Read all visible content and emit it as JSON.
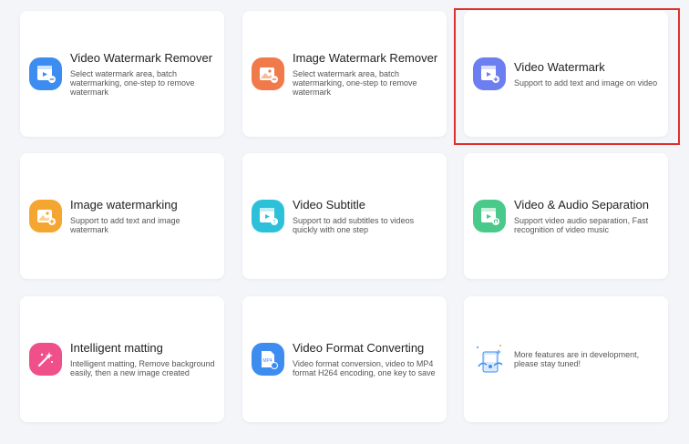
{
  "cards": [
    {
      "title": "Video Watermark Remover",
      "desc": "Select watermark area, batch watermarking, one-step to remove watermark",
      "color": "#3d8df0",
      "icon": "video-watermark-remover-icon"
    },
    {
      "title": "Image Watermark Remover",
      "desc": "Select watermark area, batch watermarking, one-step to remove watermark",
      "color": "#f07a4a",
      "icon": "image-watermark-remover-icon"
    },
    {
      "title": "Video Watermark",
      "desc": "Support to add text and image on video",
      "color": "#6c7ef0",
      "icon": "video-watermark-icon"
    },
    {
      "title": "Image watermarking",
      "desc": "Support to add text and image watermark",
      "color": "#f5a630",
      "icon": "image-watermarking-icon"
    },
    {
      "title": "Video Subtitle",
      "desc": "Support to add subtitles to videos quickly with one step",
      "color": "#2cc1d9",
      "icon": "video-subtitle-icon"
    },
    {
      "title": "Video & Audio Separation",
      "desc": "Support video audio separation, Fast recognition of video music",
      "color": "#49c98a",
      "icon": "video-audio-separation-icon"
    },
    {
      "title": "Intelligent matting",
      "desc": "Intelligent matting, Remove background easily, then a new image created",
      "color": "#f0508a",
      "icon": "intelligent-matting-icon"
    },
    {
      "title": "Video Format Converting",
      "desc": "Video format conversion, video to MP4 format H264 encoding, one key to save",
      "color": "#3d8df0",
      "icon": "video-format-converting-icon"
    }
  ],
  "more": {
    "desc": "More features are in development, please stay tuned!",
    "icon": "development-illustration-icon"
  },
  "mp4_label": "MP4",
  "selected_outline_color": "#e0302c"
}
